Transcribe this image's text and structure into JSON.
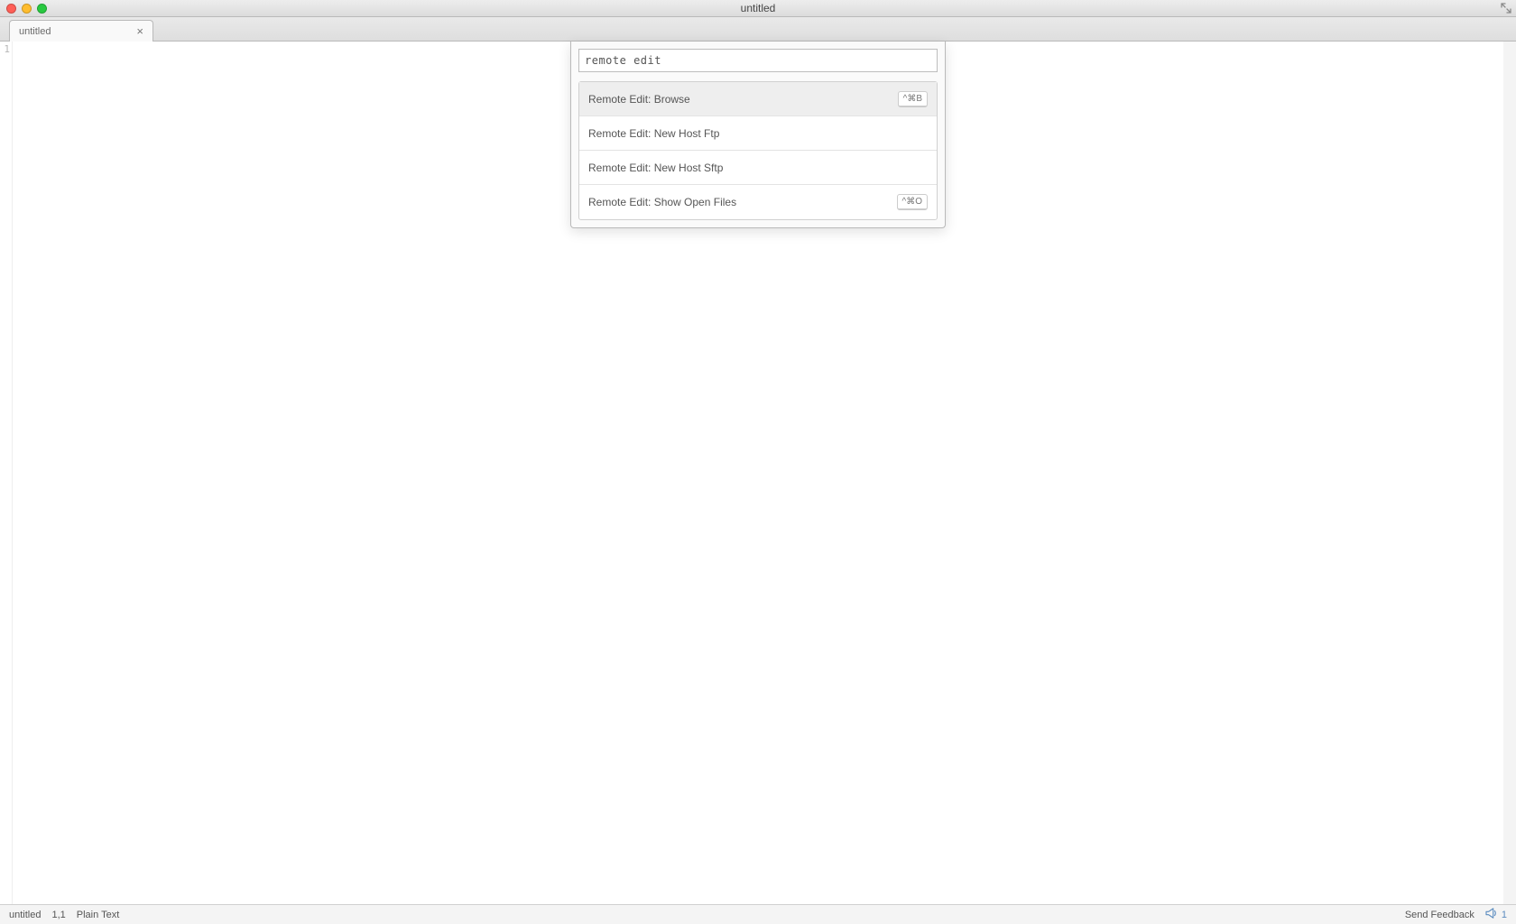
{
  "window": {
    "title": "untitled"
  },
  "tabs": [
    {
      "label": "untitled"
    }
  ],
  "gutter": {
    "line1": "1"
  },
  "palette": {
    "query": "remote edit",
    "items": [
      {
        "label": "Remote Edit: Browse",
        "shortcut": "^⌘B"
      },
      {
        "label": "Remote Edit: New Host Ftp",
        "shortcut": ""
      },
      {
        "label": "Remote Edit: New Host Sftp",
        "shortcut": ""
      },
      {
        "label": "Remote Edit: Show Open Files",
        "shortcut": "^⌘O"
      }
    ]
  },
  "statusbar": {
    "filename": "untitled",
    "cursor": "1,1",
    "grammar": "Plain Text",
    "feedback": "Send Feedback",
    "deprecations": "1"
  }
}
